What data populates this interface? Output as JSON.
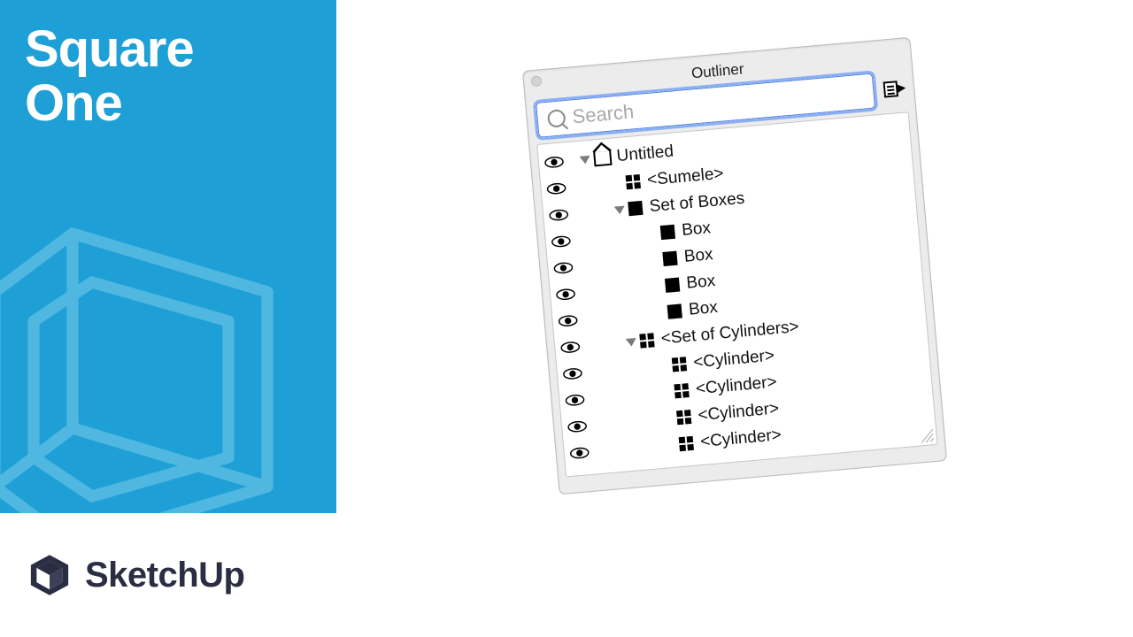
{
  "left": {
    "title_line1": "Square",
    "title_line2": "One"
  },
  "brand": {
    "name": "SketchUp"
  },
  "outliner": {
    "panel_title": "Outliner",
    "search_placeholder": "Search",
    "tree": [
      {
        "depth": 0,
        "eye": true,
        "disclose": true,
        "icon": "model",
        "label": "Untitled"
      },
      {
        "depth": 1,
        "eye": true,
        "disclose": false,
        "icon": "component",
        "label": "<Sumele>"
      },
      {
        "depth": 1,
        "eye": true,
        "disclose": true,
        "icon": "group",
        "label": "Set of Boxes"
      },
      {
        "depth": 2,
        "eye": true,
        "disclose": false,
        "icon": "group",
        "label": "Box"
      },
      {
        "depth": 2,
        "eye": true,
        "disclose": false,
        "icon": "group",
        "label": "Box"
      },
      {
        "depth": 2,
        "eye": true,
        "disclose": false,
        "icon": "group",
        "label": "Box"
      },
      {
        "depth": 2,
        "eye": true,
        "disclose": false,
        "icon": "group",
        "label": "Box"
      },
      {
        "depth": 1,
        "eye": true,
        "disclose": true,
        "icon": "component",
        "label": "<Set of Cylinders>"
      },
      {
        "depth": 2,
        "eye": true,
        "disclose": false,
        "icon": "component",
        "label": "<Cylinder>"
      },
      {
        "depth": 2,
        "eye": true,
        "disclose": false,
        "icon": "component",
        "label": "<Cylinder>"
      },
      {
        "depth": 2,
        "eye": true,
        "disclose": false,
        "icon": "component",
        "label": "<Cylinder>"
      },
      {
        "depth": 2,
        "eye": true,
        "disclose": false,
        "icon": "component",
        "label": "<Cylinder>"
      }
    ]
  }
}
